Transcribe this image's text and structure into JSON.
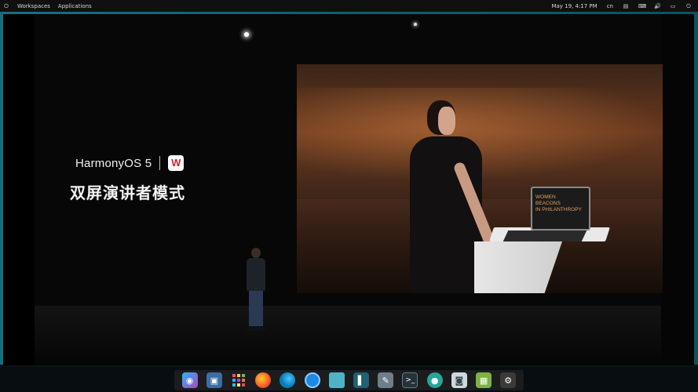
{
  "topbar": {
    "power_icon": "power-icon",
    "workspaces": "Workspaces",
    "applications": "Applications",
    "datetime": "May 19, 4:17 PM",
    "lang": "cn"
  },
  "video": {
    "brand": "HarmonyOS 5",
    "wps": "W",
    "title_cn": "双屏演讲者模式",
    "laptop_title": "WOMEN\nBEACONS\nIN PHILANTHROPY"
  },
  "dock": [
    {
      "name": "search",
      "icon": "search-icon"
    },
    {
      "name": "window-manager",
      "icon": "window-icon"
    },
    {
      "name": "apps-grid",
      "icon": "grid-icon"
    },
    {
      "name": "firefox",
      "icon": "firefox-icon"
    },
    {
      "name": "edge",
      "icon": "edge-icon"
    },
    {
      "name": "chromium",
      "icon": "browser-icon"
    },
    {
      "name": "files",
      "icon": "folder-icon"
    },
    {
      "name": "split-view",
      "icon": "split-icon"
    },
    {
      "name": "text-editor",
      "icon": "editor-icon"
    },
    {
      "name": "terminal",
      "icon": "terminal-icon"
    },
    {
      "name": "software-center",
      "icon": "store-icon"
    },
    {
      "name": "screenshot",
      "icon": "camera-icon"
    },
    {
      "name": "image-viewer",
      "icon": "image-icon"
    },
    {
      "name": "settings",
      "icon": "gear-icon"
    }
  ]
}
